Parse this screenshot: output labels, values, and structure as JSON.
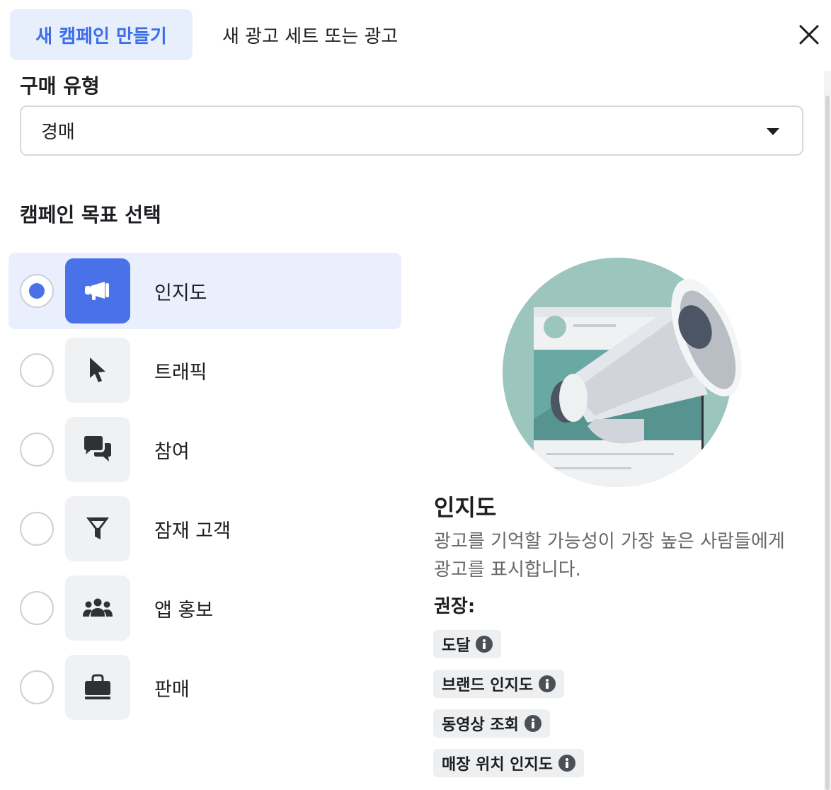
{
  "tabs": {
    "create_campaign": "새 캠페인 만들기",
    "new_adset_or_ad": "새 광고 세트 또는 광고"
  },
  "buying_type": {
    "label": "구매 유형",
    "value": "경매"
  },
  "objective_section": {
    "title": "캠페인 목표 선택",
    "objectives": [
      {
        "label": "인지도",
        "icon": "megaphone-icon",
        "selected": true
      },
      {
        "label": "트래픽",
        "icon": "cursor-icon",
        "selected": false
      },
      {
        "label": "참여",
        "icon": "chat-bubbles-icon",
        "selected": false
      },
      {
        "label": "잠재 고객",
        "icon": "funnel-icon",
        "selected": false
      },
      {
        "label": "앱 홍보",
        "icon": "people-group-icon",
        "selected": false
      },
      {
        "label": "판매",
        "icon": "shopping-bag-icon",
        "selected": false
      }
    ]
  },
  "detail": {
    "title": "인지도",
    "description": "광고를 기억할 가능성이 가장 높은 사람들에게 광고를 표시합니다.",
    "recommended_label": "권장:",
    "recommended": [
      "도달",
      "브랜드 인지도",
      "동영상 조회",
      "매장 위치 인지도"
    ]
  },
  "colors": {
    "accent": "#4a72e8",
    "selected_bg": "#e9effd",
    "tab_active_bg": "#e7eefc",
    "illustration_teal": "#9cc5be"
  }
}
